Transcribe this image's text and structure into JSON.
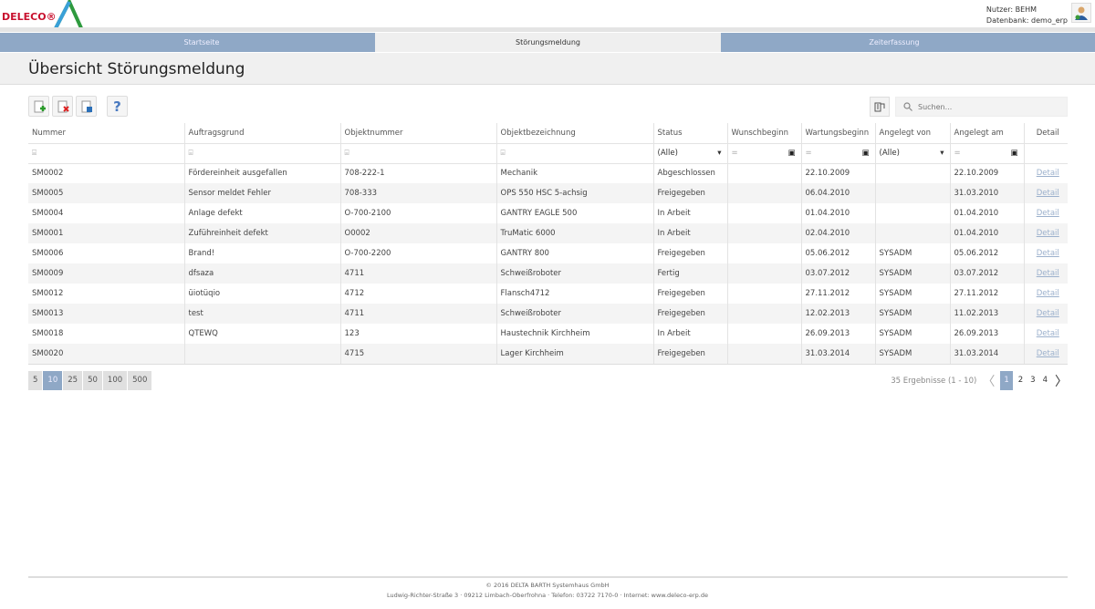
{
  "header": {
    "logo": "DELECO®",
    "user_label": "Nutzer: BEHM",
    "db_label": "Datenbank: demo_erp"
  },
  "nav": {
    "tabs": [
      {
        "label": "Startseite",
        "active": false
      },
      {
        "label": "Störungsmeldung",
        "active": true
      },
      {
        "label": "Zeiterfassung",
        "active": false
      }
    ]
  },
  "page_title": "Übersicht Störungsmeldung",
  "search": {
    "placeholder": "Suchen..."
  },
  "columns": [
    "Nummer",
    "Auftragsgrund",
    "Objektnummer",
    "Objektbezeichnung",
    "Status",
    "Wunschbeginn",
    "Wartungsbeginn",
    "Angelegt von",
    "Angelegt am",
    "Detail"
  ],
  "filters": {
    "status": "(Alle)",
    "angelegt_von": "(Alle)",
    "date_op": "="
  },
  "rows": [
    [
      "SM0002",
      "Fördereinheit ausgefallen",
      "708-222-1",
      "Mechanik",
      "Abgeschlossen",
      "",
      "22.10.2009",
      "",
      "22.10.2009",
      "Detail"
    ],
    [
      "SM0005",
      "Sensor meldet Fehler",
      "708-333",
      "OPS 550 HSC 5-achsig",
      "Freigegeben",
      "",
      "06.04.2010",
      "",
      "31.03.2010",
      "Detail"
    ],
    [
      "SM0004",
      "Anlage defekt",
      "O-700-2100",
      "GANTRY EAGLE 500",
      "In Arbeit",
      "",
      "01.04.2010",
      "",
      "01.04.2010",
      "Detail"
    ],
    [
      "SM0001",
      "Zuführeinheit defekt",
      "O0002",
      "TruMatic 6000",
      "In Arbeit",
      "",
      "02.04.2010",
      "",
      "01.04.2010",
      "Detail"
    ],
    [
      "SM0006",
      "Brand!",
      "O-700-2200",
      "GANTRY 800",
      "Freigegeben",
      "",
      "05.06.2012",
      "SYSADM",
      "05.06.2012",
      "Detail"
    ],
    [
      "SM0009",
      "dfsaza",
      "4711",
      "Schweißroboter",
      "Fertig",
      "",
      "03.07.2012",
      "SYSADM",
      "03.07.2012",
      "Detail"
    ],
    [
      "SM0012",
      "üiotüqio",
      "4712",
      "Flansch4712",
      "Freigegeben",
      "",
      "27.11.2012",
      "SYSADM",
      "27.11.2012",
      "Detail"
    ],
    [
      "SM0013",
      "test",
      "4711",
      "Schweißroboter",
      "Freigegeben",
      "",
      "12.02.2013",
      "SYSADM",
      "11.02.2013",
      "Detail"
    ],
    [
      "SM0018",
      "QTEWQ",
      "123",
      "Haustechnik Kirchheim",
      "In Arbeit",
      "",
      "26.09.2013",
      "SYSADM",
      "26.09.2013",
      "Detail"
    ],
    [
      "SM0020",
      "",
      "4715",
      "Lager Kirchheim",
      "Freigegeben",
      "",
      "31.03.2014",
      "SYSADM",
      "31.03.2014",
      "Detail"
    ]
  ],
  "page_sizes": [
    "5",
    "10",
    "25",
    "50",
    "100",
    "500"
  ],
  "selected_page_size": "10",
  "pager": {
    "summary": "35 Ergebnisse (1 - 10)",
    "pages": [
      "1",
      "2",
      "3",
      "4"
    ],
    "current": "1"
  },
  "footer": {
    "line1": "© 2016 DELTA BARTH Systemhaus GmbH",
    "line2": "Ludwig-Richter-Straße 3 · 09212 Limbach-Oberfrohna · Telefon: 03722 7170-0 · Internet: www.deleco-erp.de"
  },
  "colors": {
    "accent": "#8fa8c6",
    "logo_red": "#c8102e"
  }
}
